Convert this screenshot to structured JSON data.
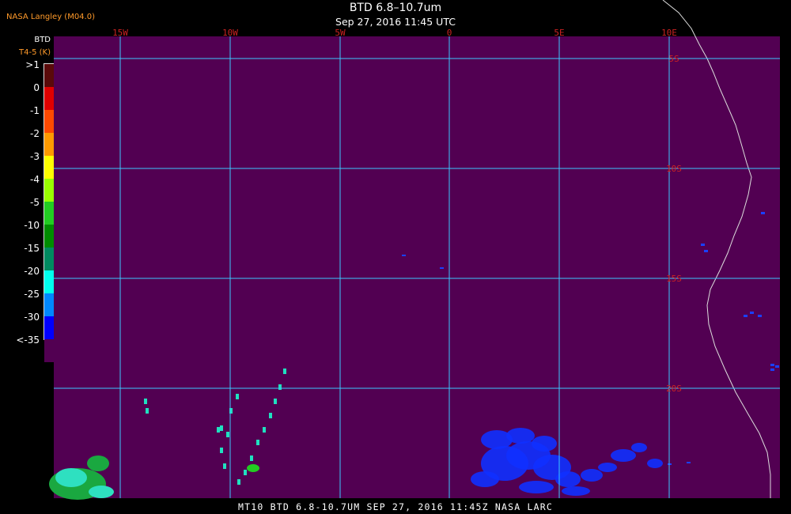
{
  "header": {
    "agency": "NASA Langley (M04.0)",
    "title": "BTD 6.8–10.7um",
    "subtitle": "Sep 27, 2016 11:45 UTC"
  },
  "legend": {
    "title": "BTD",
    "subtitle": "T4-5 (K)",
    "levels": [
      {
        "label": ">1",
        "color": "#5a0a0a"
      },
      {
        "label": "0",
        "color": "#e00000"
      },
      {
        "label": "-1",
        "color": "#ff4a00"
      },
      {
        "label": "-2",
        "color": "#ff9a00"
      },
      {
        "label": "-3",
        "color": "#ffff00"
      },
      {
        "label": "-4",
        "color": "#99ff00"
      },
      {
        "label": "-5",
        "color": "#22cc22"
      },
      {
        "label": "-10",
        "color": "#008c00"
      },
      {
        "label": "-15",
        "color": "#008a60"
      },
      {
        "label": "-20",
        "color": "#00ffee"
      },
      {
        "label": "-25",
        "color": "#0088ff"
      },
      {
        "label": "-30",
        "color": "#0000ff"
      },
      {
        "label": "<-35",
        "color": "#520052"
      }
    ]
  },
  "map": {
    "background_color": "#520052",
    "grid_color": "#3cc8ff",
    "grid_label_color": "#cc2222",
    "longitude_labels": [
      "15W",
      "10W",
      "5W",
      "0",
      "5E",
      "10E"
    ],
    "latitude_labels": [
      "5S",
      "10S",
      "15S",
      "20S"
    ]
  },
  "footer": {
    "text": "MT10  BTD 6.8-10.7UM  SEP 27, 2016 11:45Z  NASA LARC"
  }
}
